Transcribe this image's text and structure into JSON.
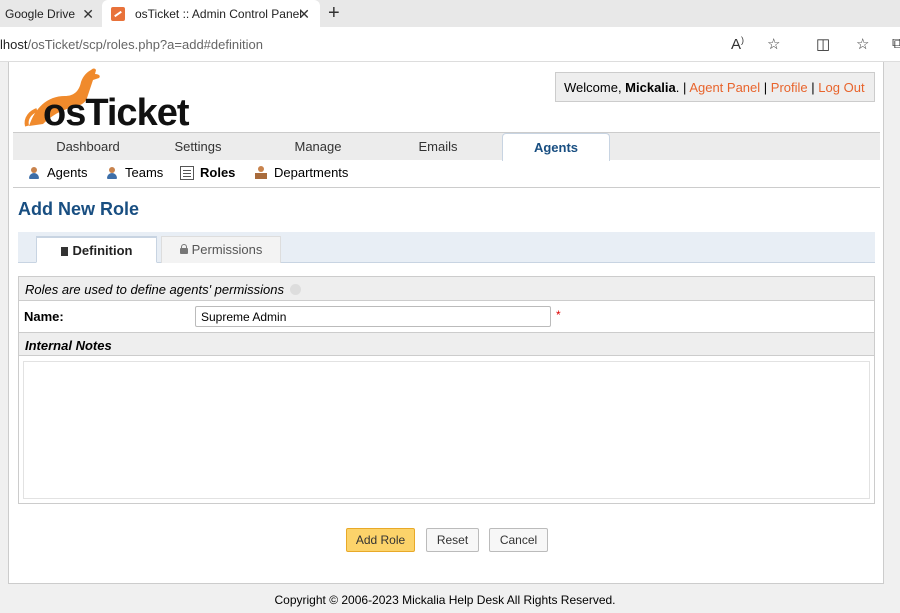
{
  "browser": {
    "tabs": [
      {
        "label": "Google Drive"
      },
      {
        "label": "osTicket :: Admin Control Panel"
      }
    ],
    "url_host": "lhost",
    "url_path": "/osTicket/scp/roles.php?a=add#definition"
  },
  "header": {
    "logo_text": "osTicket",
    "welcome_prefix": "Welcome, ",
    "user_name": "Mickalia",
    "welcome_suffix": ".",
    "sep": "|",
    "links": {
      "agent_panel": "Agent Panel",
      "profile": "Profile",
      "logout": "Log Out"
    }
  },
  "nav": {
    "tabs": [
      {
        "label": "Dashboard"
      },
      {
        "label": "Settings"
      },
      {
        "label": "Manage"
      },
      {
        "label": "Emails"
      },
      {
        "label": "Agents"
      }
    ],
    "active": "Agents"
  },
  "subnav": {
    "items": [
      {
        "label": "Agents",
        "icon": "agent-icon"
      },
      {
        "label": "Teams",
        "icon": "teams-icon"
      },
      {
        "label": "Roles",
        "icon": "list-icon"
      },
      {
        "label": "Departments",
        "icon": "department-icon"
      }
    ],
    "active": "Roles"
  },
  "page": {
    "title": "Add New Role",
    "form_tabs": [
      {
        "label": "Definition"
      },
      {
        "label": "Permissions"
      }
    ],
    "active_form_tab": "Definition",
    "description": "Roles are used to define agents' permissions",
    "name_label": "Name:",
    "name_value": "Supreme Admin",
    "required_marker": "*",
    "notes_header": "Internal Notes",
    "notes_value": ""
  },
  "buttons": {
    "submit": "Add Role",
    "reset": "Reset",
    "cancel": "Cancel"
  },
  "footer": {
    "text": "Copyright © 2006-2023 Mickalia Help Desk All Rights Reserved."
  },
  "colors": {
    "link": "#e8642c",
    "title": "#184e81",
    "primary_button": "#fcd36a",
    "logo_kangaroo": "#f08a2c"
  }
}
